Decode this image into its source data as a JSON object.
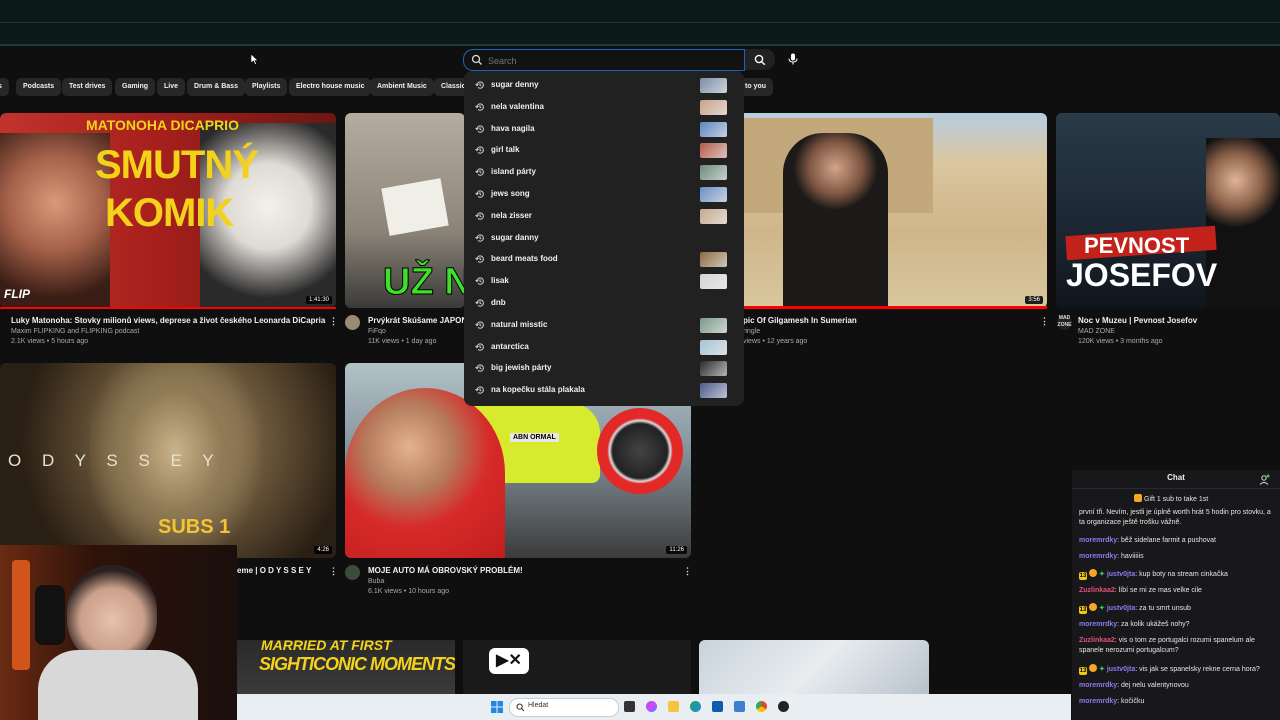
{
  "search": {
    "placeholder": "Search",
    "value": ""
  },
  "chips": [
    "Podcasts",
    "Test drives",
    "Gaming",
    "Live",
    "Drum & Bass",
    "Playlists",
    "Electro house music",
    "Ambient Music",
    "Classic",
    "to you"
  ],
  "suggestions": [
    {
      "text": "sugar denny",
      "thumb": true
    },
    {
      "text": "nela valentina",
      "thumb": true
    },
    {
      "text": "hava nagila",
      "thumb": true
    },
    {
      "text": "girl talk",
      "thumb": true
    },
    {
      "text": "island párty",
      "thumb": true
    },
    {
      "text": "jews song",
      "thumb": true
    },
    {
      "text": "nela zisser",
      "thumb": true
    },
    {
      "text": "sugar danny",
      "thumb": false
    },
    {
      "text": "beard meats food",
      "thumb": true
    },
    {
      "text": "lisak",
      "thumb": true
    },
    {
      "text": "dnb",
      "thumb": false
    },
    {
      "text": "natural misstic",
      "thumb": true
    },
    {
      "text": "antarctica",
      "thumb": true
    },
    {
      "text": "big jewish párty",
      "thumb": true
    },
    {
      "text": "na kopečku stála plakala",
      "thumb": true
    }
  ],
  "videos": {
    "v1": {
      "thumb_top": "MATONOHA DICAPRIO",
      "thumb_big1": "SMUTNÝ",
      "thumb_big2": "KOMIK",
      "thumb_logo": "FLIP",
      "duration": "1:41:30",
      "title": "Luky Matonoha: Stovky milionů views, deprese a život českého Leonarda DiCapria",
      "channel": "Maxim FLIPKING and FLIPKING podcast",
      "meta": "2.1K views • 5 hours ago"
    },
    "v2": {
      "thumb_text": "UŽ N",
      "title": "Prvýkrát Skúšame JAPONS",
      "channel": "FiFqo",
      "meta": "11K views • 1 day ago"
    },
    "v3": {
      "duration": "3:56",
      "title": "pic Of Gilgamesh In Sumerian",
      "channel": "ringle",
      "meta": "views • 12 years ago"
    },
    "v4": {
      "thumb_text1": "PEVNOST",
      "thumb_text2": "JOSEFOV",
      "title": "Noc v Muzeu  | Pevnost Josefov",
      "channel": "MAD ZONE",
      "meta": "120K views • 3 months ago"
    },
    "v5": {
      "thumb_letters": "O  D  Y  S  S  E  Y",
      "thumb_sub": "SUBS 1",
      "duration": "4:26",
      "title": "eme | O D Y S S E Y"
    },
    "v6": {
      "thumb_plate": "ABN ORMAL",
      "duration": "11:26",
      "title": "MOJE AUTO MÁ OBROVSKÝ PROBLÉM!",
      "channel": "Buba",
      "meta": "6.1K views • 10 hours ago"
    },
    "v7": {
      "thumb_text1": "MARRIED AT FIRST",
      "thumb_text2": "SIGHTICONIC MOMENTS"
    }
  },
  "chat": {
    "title": "Chat",
    "gift": "Gift 1 sub to take 1st",
    "messages": [
      {
        "user": "",
        "text": "první tři. Nevím, jestli je úplně worth hrát 5 hodin pro stovku, a ta organizace ještě trošku vážně.",
        "color": "#e6e6e6"
      },
      {
        "user": "moremrdky",
        "text": "běž sidelane farmit a pushovat",
        "color": "#8a7cf0"
      },
      {
        "user": "moremrdky",
        "text": "haviiiiis",
        "color": "#8a7cf0"
      },
      {
        "user": "justv0jta",
        "text": "kup boty na stream cinkačka",
        "color": "#8a7cf0",
        "badges": true
      },
      {
        "user": "Zuzlinkaa2",
        "text": "líbí se mi ze mas velke cile",
        "color": "#e0507a"
      },
      {
        "user": "justv0jta",
        "text": "za tu smrt unsub",
        "color": "#8a7cf0",
        "badges": true
      },
      {
        "user": "moremrdky",
        "text": "za kolik ukážeš nohy?",
        "color": "#8a7cf0"
      },
      {
        "user": "Zuzlinkaa2",
        "text": "vis o tom ze portugalci rozumi spanelum ale spanele nerozumi portugalcum?",
        "color": "#e0507a"
      },
      {
        "user": "justv0jta",
        "text": "vis jak se spanelsky rekne cerna hora?",
        "color": "#8a7cf0",
        "badges": true
      },
      {
        "user": "moremrdky",
        "text": "dej nelu valentynovou",
        "color": "#8a7cf0"
      },
      {
        "user": "moremrdky",
        "text": "kočičku",
        "color": "#8a7cf0"
      }
    ]
  },
  "taskbar": {
    "search_label": "Hledat"
  },
  "colors": {
    "accent_blue": "#1c62b9",
    "progress_red": "#ff0000",
    "chat_purple": "#8a7cf0",
    "chat_pink": "#e0507a"
  }
}
